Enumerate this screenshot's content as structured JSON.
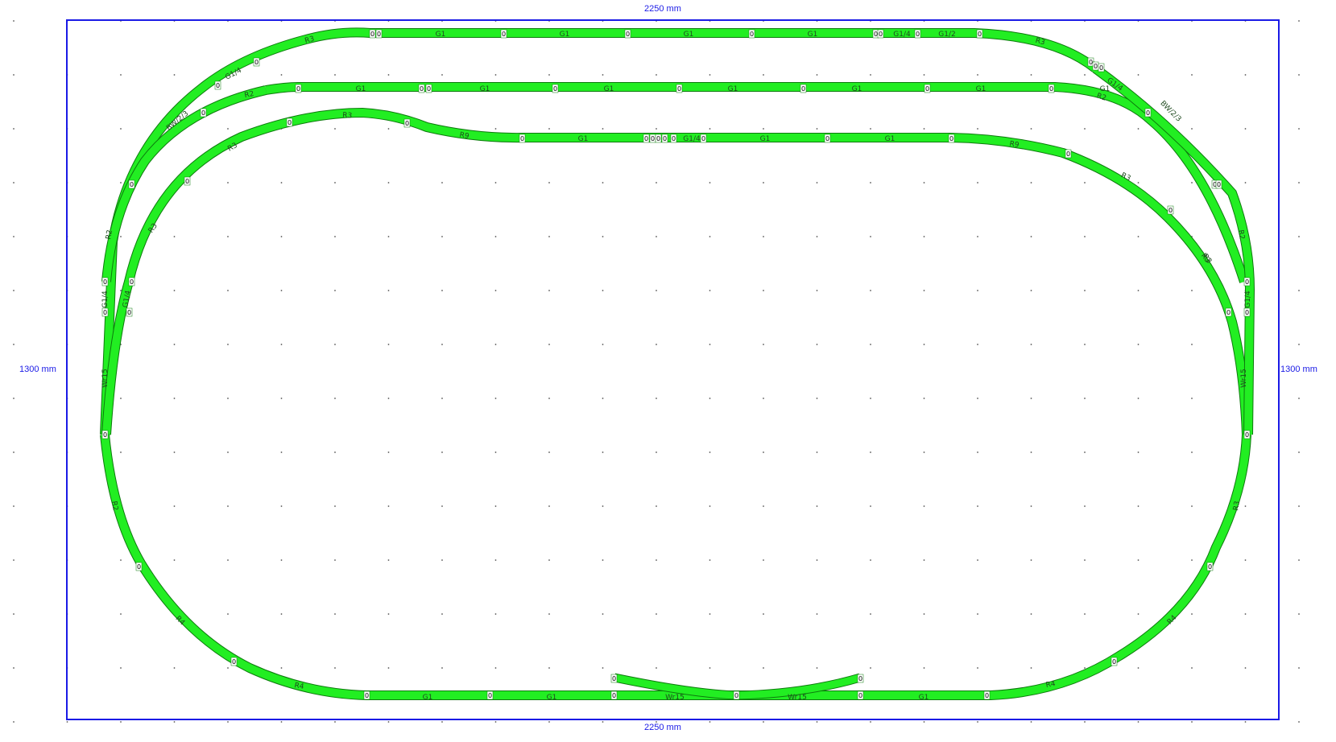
{
  "dimensions": {
    "top": "2250 mm",
    "bottom": "2250 mm",
    "left": "1300 mm",
    "right": "1300 mm"
  },
  "colors": {
    "track": "#22ee22",
    "track_edge": "#0d7a0d",
    "board_border": "#1a1ae6",
    "grid_dot": "#555555"
  },
  "track_labels": {
    "outer_top": [
      "R3",
      "G1",
      "G1",
      "G1",
      "G1",
      "G1/4",
      "G1/2",
      "R3"
    ],
    "middle_top": [
      "R2",
      "G1",
      "G1",
      "G1",
      "G1",
      "G1",
      "G1",
      "G1",
      "R2"
    ],
    "inner_top": [
      "R3",
      "R3",
      "R9",
      "G1",
      "G1/4",
      "G1",
      "G1",
      "R9",
      "R3",
      "R3"
    ],
    "left_side": [
      "BW/2/3",
      "G1/4",
      "R2",
      "R3",
      "G1/4",
      "G1/4",
      "Wr15",
      "R2"
    ],
    "right_side": [
      "G1/4",
      "BW/2/3",
      "R2",
      "R3",
      "G1/4",
      "Wr15",
      "R3"
    ],
    "bottom": [
      "R4",
      "R4",
      "G1",
      "G1",
      "Wr15",
      "Wr15",
      "G1",
      "R4",
      "R4"
    ]
  },
  "node_label": "0"
}
